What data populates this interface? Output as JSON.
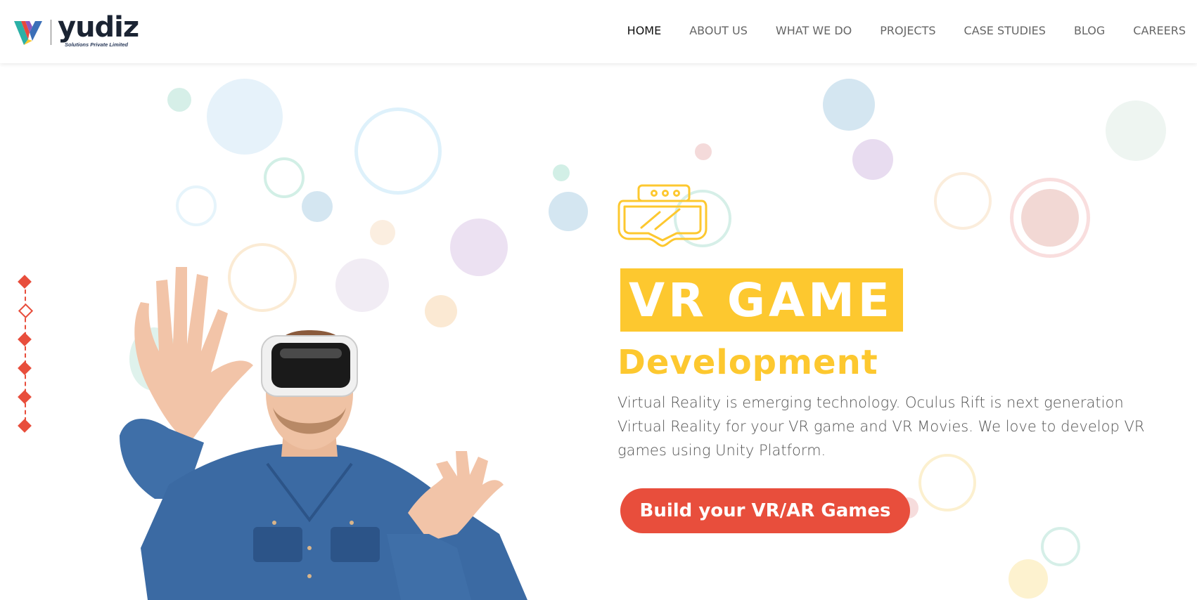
{
  "brand": {
    "name": "yudiz",
    "tagline": "Solutions Private Limited"
  },
  "nav": {
    "items": [
      {
        "label": "HOME",
        "active": true
      },
      {
        "label": "ABOUT US",
        "active": false
      },
      {
        "label": "WHAT WE DO",
        "active": false
      },
      {
        "label": "PROJECTS",
        "active": false
      },
      {
        "label": "CASE STUDIES",
        "active": false
      },
      {
        "label": "BLOG",
        "active": false
      },
      {
        "label": "CAREERS",
        "active": false
      }
    ]
  },
  "hero": {
    "icon": "vr-headset-icon",
    "title": "VR GAME",
    "subtitle": "Development",
    "description": "Virtual Reality is emerging technology. Oculus Rift is next generation Virtual Reality for your VR game and VR Movies. We love to develop VR games using Unity Platform.",
    "cta_label": "Build your VR/AR Games"
  },
  "slider": {
    "count": 6,
    "active_index": 1
  },
  "colors": {
    "accent_yellow": "#fdc82f",
    "accent_red": "#e84e3c",
    "nav_text": "#666666",
    "nav_active": "#111111",
    "body_text": "#555555"
  }
}
